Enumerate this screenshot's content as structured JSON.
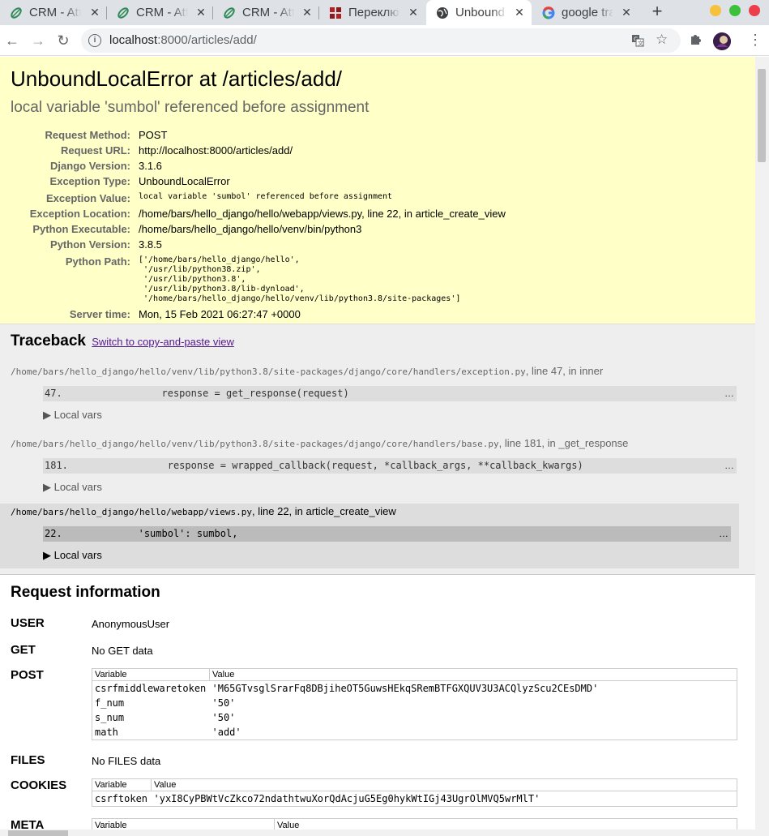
{
  "browser": {
    "tabs": [
      {
        "title": "CRM - Attr",
        "icon": "crm-leaf-icon",
        "active": false
      },
      {
        "title": "CRM - Attr",
        "icon": "crm-leaf-icon",
        "active": false
      },
      {
        "title": "CRM - Attr",
        "icon": "crm-leaf-icon",
        "active": false
      },
      {
        "title": "Переключ",
        "icon": "red-squares-icon",
        "active": false
      },
      {
        "title": "Unbound",
        "icon": "globe-icon",
        "active": true
      },
      {
        "title": "google tra",
        "icon": "google-icon",
        "active": false
      }
    ],
    "url_host": "localhost",
    "url_rest": ":8000/articles/add/"
  },
  "error": {
    "title": "UnboundLocalError at /articles/add/",
    "message": "local variable 'sumbol' referenced before assignment",
    "meta": [
      {
        "key": "Request Method:",
        "value": "POST",
        "mono": false
      },
      {
        "key": "Request URL:",
        "value": "http://localhost:8000/articles/add/",
        "mono": false
      },
      {
        "key": "Django Version:",
        "value": "3.1.6",
        "mono": false
      },
      {
        "key": "Exception Type:",
        "value": "UnboundLocalError",
        "mono": false
      },
      {
        "key": "Exception Value:",
        "value": "local variable 'sumbol' referenced before assignment",
        "mono": true
      },
      {
        "key": "Exception Location:",
        "value": "/home/bars/hello_django/hello/webapp/views.py, line 22, in article_create_view",
        "mono": false
      },
      {
        "key": "Python Executable:",
        "value": "/home/bars/hello_django/hello/venv/bin/python3",
        "mono": false
      },
      {
        "key": "Python Version:",
        "value": "3.8.5",
        "mono": false
      },
      {
        "key": "Python Path:",
        "value": "['/home/bars/hello_django/hello',\n '/usr/lib/python38.zip',\n '/usr/lib/python3.8',\n '/usr/lib/python3.8/lib-dynload',\n '/home/bars/hello_django/hello/venv/lib/python3.8/site-packages']",
        "mono": true
      },
      {
        "key": "Server time:",
        "value": "Mon, 15 Feb 2021 06:27:47 +0000",
        "mono": false
      }
    ]
  },
  "traceback": {
    "heading": "Traceback",
    "switch_link": "Switch to copy-and-paste view",
    "local_vars_label": "▶ Local vars",
    "frames": [
      {
        "file": "/home/bars/hello_django/hello/venv/lib/python3.8/site-packages/django/core/handlers/exception.py",
        "where": ", line 47, in inner",
        "line": "47.                 response = get_response(request)",
        "user": false
      },
      {
        "file": "/home/bars/hello_django/hello/venv/lib/python3.8/site-packages/django/core/handlers/base.py",
        "where": ", line 181, in _get_response",
        "line": "181.                 response = wrapped_callback(request, *callback_args, **callback_kwargs)",
        "user": false
      },
      {
        "file": "/home/bars/hello_django/hello/webapp/views.py",
        "where": ", line 22, in article_create_view",
        "line": "22.             'sumbol': sumbol,",
        "user": true
      }
    ],
    "ellipsis": "…"
  },
  "request": {
    "heading": "Request information",
    "user_label": "USER",
    "user_value": "AnonymousUser",
    "get_label": "GET",
    "get_value": "No GET data",
    "post_label": "POST",
    "col_variable": "Variable",
    "col_value": "Value",
    "post_rows": [
      {
        "name": "csrfmiddlewaretoken",
        "value": "'M65GTvsglSrarFq8DBjiheOT5GuwsHEkqSRemBTFGXQUV3U3ACQlyzScu2CEsDMD'"
      },
      {
        "name": "f_num",
        "value": "'50'"
      },
      {
        "name": "s_num",
        "value": "'50'"
      },
      {
        "name": "math",
        "value": "'add'"
      }
    ],
    "files_label": "FILES",
    "files_value": "No FILES data",
    "cookies_label": "COOKIES",
    "cookie_rows": [
      {
        "name": "csrftoken",
        "value": "'yxI8CyPBWtVcZkco72ndathtwuXorQdAcjuG5Eg0hykWtIGj43UgrOlMVQ5wrMlT'"
      }
    ],
    "meta_label": "META"
  }
}
